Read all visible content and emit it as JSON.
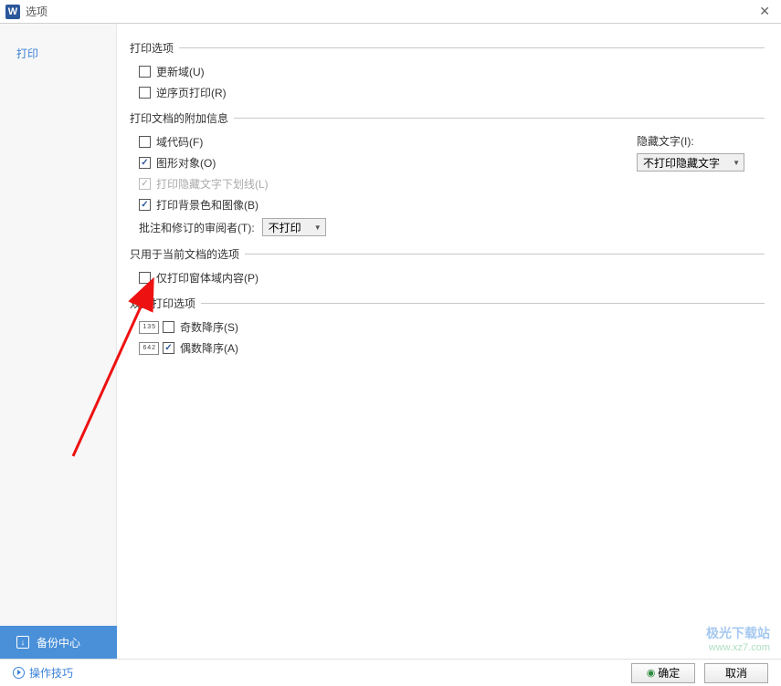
{
  "window": {
    "title": "选项",
    "icon_letter": "W"
  },
  "sidebar": {
    "items": [
      {
        "label": "打印"
      }
    ]
  },
  "sections": {
    "print_options": {
      "title": "打印选项",
      "update_fields": "更新域(U)",
      "reverse_print": "逆序页打印(R)"
    },
    "additional_info": {
      "title": "打印文档的附加信息",
      "field_codes": "域代码(F)",
      "graphic_objects": "图形对象(O)",
      "hidden_underline": "打印隐藏文字下划线(L)",
      "background": "打印背景色和图像(B)",
      "reviewer_label": "批注和修订的审阅者(T):",
      "reviewer_value": "不打印",
      "hidden_text_label": "隐藏文字(I):",
      "hidden_text_value": "不打印隐藏文字"
    },
    "current_doc": {
      "title": "只用于当前文档的选项",
      "form_fields_only": "仅打印窗体域内容(P)"
    },
    "duplex": {
      "title": "双面打印选项",
      "odd_desc": "奇数降序(S)",
      "even_desc": "偶数降序(A)",
      "odd_icon": "1 3 5",
      "even_icon": "6 4 2"
    }
  },
  "backup": {
    "label": "备份中心"
  },
  "footer": {
    "tips": "操作技巧",
    "ok": "确定",
    "cancel": "取消"
  },
  "watermark": {
    "line1": "极光下载站",
    "line2": "www.xz7.com"
  }
}
